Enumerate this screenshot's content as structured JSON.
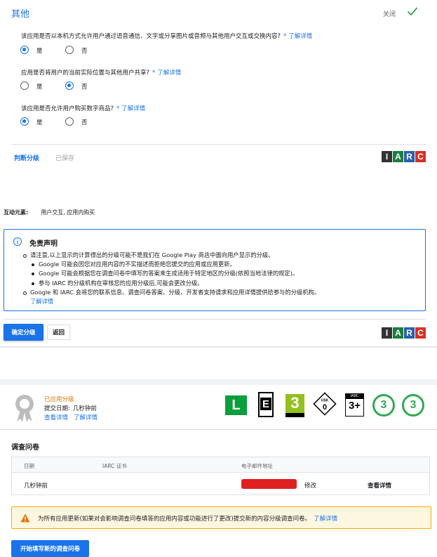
{
  "section_other": {
    "title": "其他",
    "close_label": "关闭",
    "questions": [
      {
        "text": "该应用是否以本机方式允许用户通过语音通信、文字或分享图片或音频与其他用户交互或交换内容?",
        "required": "*",
        "link": "了解详情",
        "options": [
          "是",
          "否"
        ],
        "selected": "是"
      },
      {
        "text": "应用是否将用户的当前实际位置与其他用户共享?",
        "required": "*",
        "link": "了解详情",
        "options": [
          "是",
          "否"
        ],
        "selected": "否"
      },
      {
        "text": "该应用是否允许用户购买数字商品?",
        "required": "*",
        "link": "了解详情",
        "options": [
          "是",
          "否"
        ],
        "selected": "是"
      }
    ],
    "calculate_link": "判断分级",
    "saved_label": "已保存"
  },
  "iarc_logo": {
    "letters": [
      "I",
      "A",
      "R",
      "C"
    ],
    "colors": [
      "#333333",
      "#1a7f3c",
      "#2b5fad",
      "#d93025"
    ]
  },
  "summary": {
    "interactive_label": "互动元素:",
    "interactive_value": "用户交互, 应用内购买"
  },
  "disclaimer": {
    "title": "免责声明",
    "items": [
      "请注意,以上显示的计算得出的分级可能不是我们在 Google Play 商店中面向用户显示的分级。",
      "Google 和 IARC 会将您的联系信息、调查问卷答案、分级、开发者支持请求和应用详情提供给参与的分级机构。"
    ],
    "subitems": [
      "Google 可能会因您对应用内容的不实描述而拒绝您提交的应用或应用更新。",
      "Google 可能会根据您在调查问卷中填写的答案来生成适用于特定地区的分级(依照当地法律的规定)。",
      "参与 IARC 的分级机构在审核您的应用分级后,可能会更改分级。"
    ],
    "more_link": "了解详情"
  },
  "actions": {
    "confirm": "确定分级",
    "back": "返回"
  },
  "applied": {
    "status": "已应用分级",
    "submit_label": "提交日期:",
    "submit_value": "几秒钟前",
    "view_details": "查看详情",
    "learn_more": "了解详情",
    "ratings": {
      "l": "L",
      "esrb": "E",
      "pegi": "3",
      "usk": "0",
      "usk_label": "USK",
      "iarc": "3+",
      "iarc_label": "IARC",
      "circle1": "3",
      "circle2": "3"
    }
  },
  "survey": {
    "title": "调查问卷",
    "columns": [
      "日期",
      "IARC 证书",
      "电子邮件地址"
    ],
    "row": {
      "date": "几秒钟前",
      "edit": "修改",
      "view": "查看详情"
    }
  },
  "warning": {
    "text": "为所有应用更新(如果对会影响调查问卷填答的应用内容或功能进行了更改)提交新的内容分级调查问卷。",
    "link": "了解详情"
  },
  "start_button": "开始填写新的调查问卷"
}
